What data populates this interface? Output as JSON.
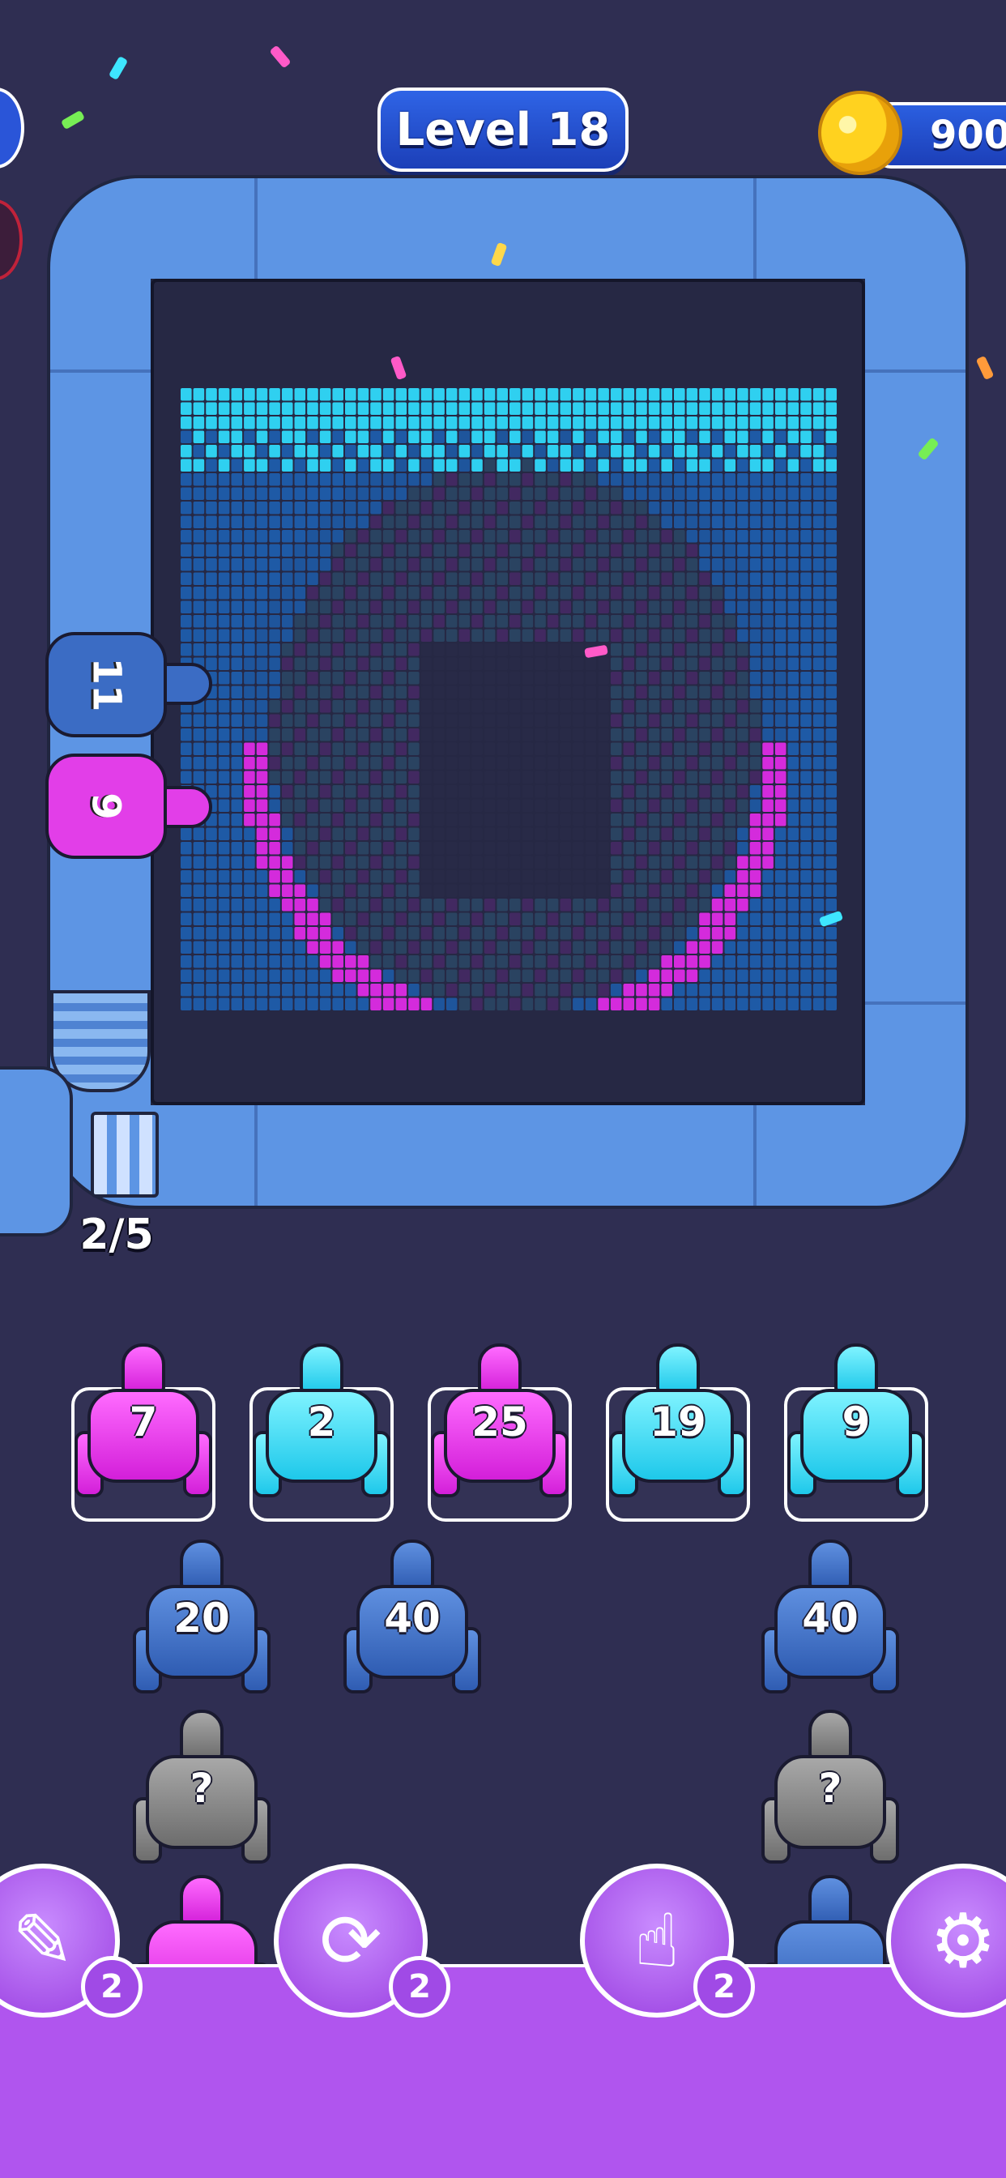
{
  "header": {
    "level_label": "Level 18",
    "coins": "900"
  },
  "board": {
    "conveyor_counter": "2/5",
    "shooters": [
      {
        "color": "#3b6cc4",
        "ammo": "11"
      },
      {
        "color": "#e23ee8",
        "ammo": "9"
      }
    ]
  },
  "queue": {
    "row1": [
      {
        "color": "magenta",
        "ammo": "7"
      },
      {
        "color": "cyan",
        "ammo": "2"
      },
      {
        "color": "magenta",
        "ammo": "25"
      },
      {
        "color": "cyan",
        "ammo": "19"
      },
      {
        "color": "cyan",
        "ammo": "9"
      }
    ],
    "row2": [
      {
        "color": "blue",
        "ammo": "20"
      },
      {
        "color": "blue",
        "ammo": "40"
      },
      {
        "color": "blue",
        "ammo": "40"
      }
    ],
    "row3": [
      {
        "color": "gray",
        "ammo": "?"
      },
      {
        "color": "gray",
        "ammo": "?"
      }
    ]
  },
  "powerups": [
    {
      "icon": "add-slot-icon",
      "count": "2"
    },
    {
      "icon": "shuffle-icon",
      "count": "2"
    },
    {
      "icon": "hand-pointer-icon",
      "count": "2"
    },
    {
      "icon": "robot-icon",
      "count": ""
    }
  ],
  "colors": {
    "magenta": "#e23ee8",
    "cyan": "#34d6f2",
    "blue": "#2f5cb2",
    "gray": "#8a8a8a",
    "pipe": "#5d95e4",
    "background": "#2f2e52",
    "bottom_bar": "#b055ee"
  }
}
